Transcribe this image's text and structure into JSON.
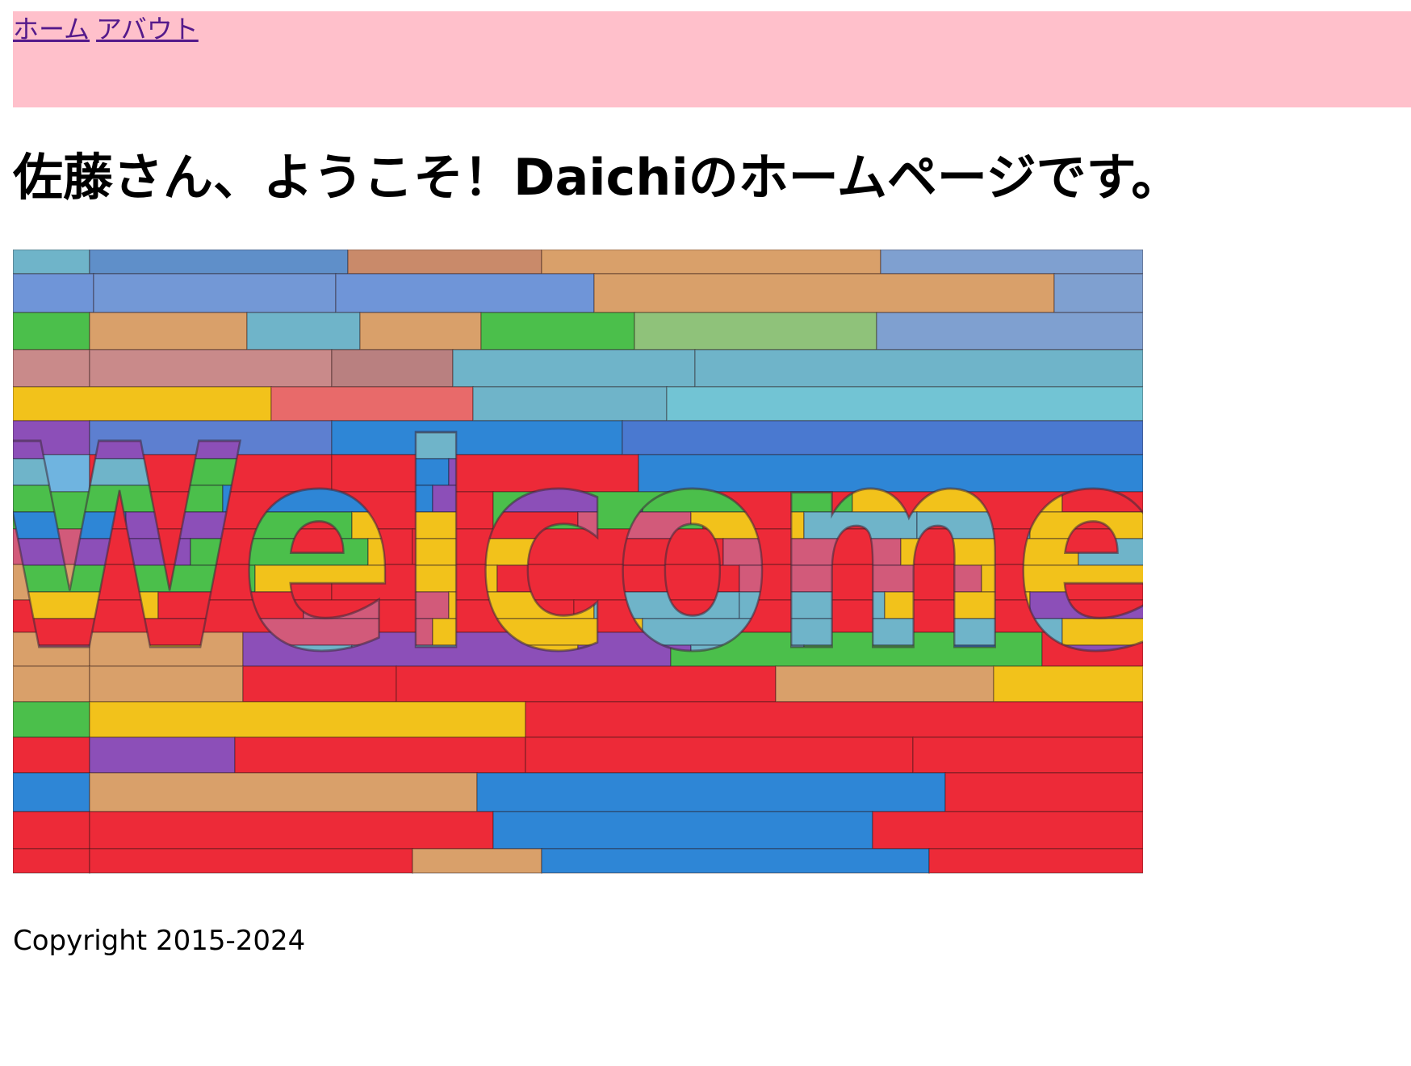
{
  "nav": {
    "home_label": "ホーム",
    "about_label": "アバウト",
    "background": "#ffc0cb",
    "link_color": "#551a8b"
  },
  "main": {
    "heading": "佐藤さん、ようこそ！Daichiのホームページです。",
    "hero_image": {
      "text": "Welcome",
      "icon": "welcome-wooden-sign-image",
      "palette": [
        "#ed2a38",
        "#2e86d6",
        "#4bbf4b",
        "#f2c21b",
        "#8c4fb8",
        "#6fb4c9",
        "#d9a06a",
        "#9b7fcf"
      ]
    }
  },
  "footer": {
    "copyright": "Copyright 2015-2024"
  }
}
